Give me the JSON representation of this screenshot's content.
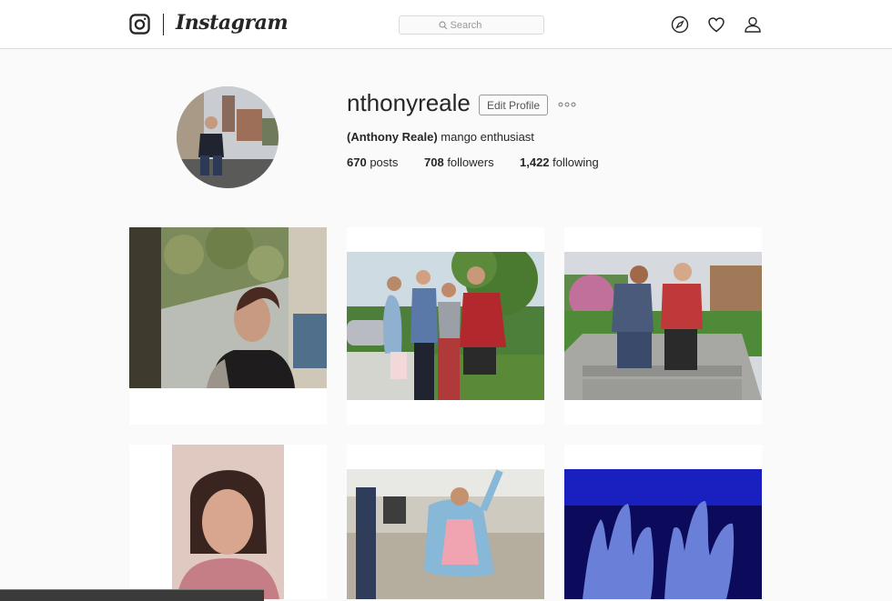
{
  "header": {
    "brand": "Instagram",
    "search_placeholder": "Search",
    "icons": [
      "instagram-glyph-icon",
      "search-icon",
      "explore-compass-icon",
      "heart-icon",
      "profile-icon"
    ]
  },
  "profile": {
    "username": "nthonyreale",
    "edit_label": "Edit Profile",
    "full_name": "(Anthony Reale)",
    "bio": " mango enthusiast",
    "stats": {
      "posts_count": "670",
      "posts_label": " posts",
      "followers_count": "708",
      "followers_label": " followers",
      "following_count": "1,422",
      "following_label": " following"
    }
  },
  "posts": [
    {
      "subject": "woman-on-train"
    },
    {
      "subject": "group-of-four-friends"
    },
    {
      "subject": "two-friends-on-steps"
    },
    {
      "subject": "smiling-woman-portrait"
    },
    {
      "subject": "woman-in-subway-station"
    },
    {
      "subject": "hands-under-blue-light"
    }
  ],
  "colors": {
    "background": "#fafafa",
    "border": "#dbdbdb",
    "text": "#262626"
  }
}
